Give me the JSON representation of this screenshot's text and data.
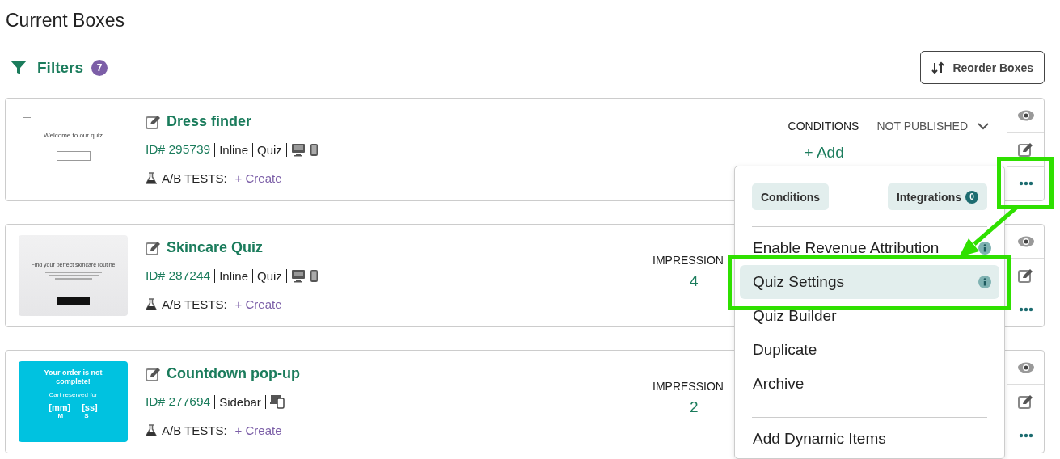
{
  "page": {
    "title": "Current Boxes"
  },
  "filters": {
    "label": "Filters",
    "count": "7"
  },
  "reorder_button": {
    "label": "Reorder Boxes"
  },
  "boxes": [
    {
      "title": "Dress finder",
      "id": "ID# 295739",
      "meta": [
        "Inline",
        "Quiz"
      ],
      "devices": {
        "kind": "separate"
      },
      "ab_label": "A/B TESTS:",
      "ab_action": "+ Create",
      "thumbnail": {
        "kind": "quiz-welcome",
        "texts": [
          "Welcome to our quiz"
        ]
      },
      "stats": {
        "kind": "conditions",
        "label": "CONDITIONS",
        "status": "NOT PUBLISHED",
        "action": "+ Add"
      }
    },
    {
      "title": "Skincare Quiz",
      "id": "ID# 287244",
      "meta": [
        "Inline",
        "Quiz"
      ],
      "devices": {
        "kind": "separate"
      },
      "ab_label": "A/B TESTS:",
      "ab_action": "+ Create",
      "thumbnail": {
        "kind": "skincare",
        "texts": [
          "Find your perfect skincare routine"
        ]
      },
      "stats": {
        "kind": "impressions",
        "label": "IMPRESSION",
        "value": "4"
      }
    },
    {
      "title": "Countdown pop-up",
      "id": "ID# 277694",
      "meta": [
        "Sidebar"
      ],
      "devices": {
        "kind": "combined"
      },
      "ab_label": "A/B TESTS:",
      "ab_action": "+ Create",
      "thumbnail": {
        "kind": "countdown",
        "texts": [
          "Your order is not complete!",
          "Cart reserved for",
          "[mm]",
          "[ss]",
          "M",
          "S"
        ]
      },
      "stats": {
        "kind": "impressions",
        "label": "IMPRESSION",
        "value": "2"
      }
    }
  ],
  "menu": {
    "chips": [
      {
        "label": "Conditions"
      },
      {
        "label": "Integrations",
        "count": "0"
      }
    ],
    "sections": [
      [
        {
          "label": "Enable Revenue Attribution",
          "info": true,
          "selected": false
        },
        {
          "label": "Quiz Settings",
          "info": true,
          "selected": true
        },
        {
          "label": "Quiz Builder",
          "info": false,
          "selected": false
        },
        {
          "label": "Duplicate",
          "info": false,
          "selected": false
        },
        {
          "label": "Archive",
          "info": false,
          "selected": false
        }
      ],
      [
        {
          "label": "Add Dynamic Items",
          "info": false,
          "selected": false
        }
      ]
    ]
  },
  "annotation": {
    "kind": "highlight-arrow"
  }
}
